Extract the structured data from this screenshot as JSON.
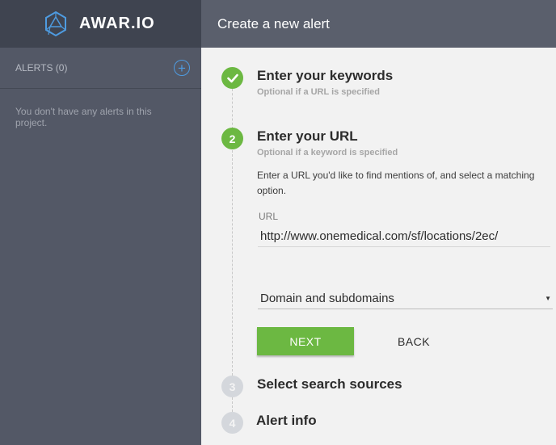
{
  "brand": {
    "name": "AWAR.IO",
    "logo_icon": "hexagon-logo-icon",
    "logo_color": "#4e9be0"
  },
  "header": {
    "title": "Create a new alert"
  },
  "sidebar": {
    "alerts_title": "ALERTS (0)",
    "add_icon": "plus-circle-icon",
    "empty_message": "You don't have any alerts in this project."
  },
  "steps": [
    {
      "number": "",
      "icon": "checkmark-icon",
      "status": "done",
      "title": "Enter your keywords",
      "subtitle": "Optional if a URL is specified"
    },
    {
      "number": "2",
      "status": "active",
      "title": "Enter your URL",
      "subtitle": "Optional if a keyword is specified",
      "description": "Enter a URL you'd like to find mentions of, and select a matching option.",
      "url_label": "URL",
      "url_value": "http://www.onemedical.com/sf/locations/2ec/",
      "match_option": "Domain and subdomains",
      "next_label": "NEXT",
      "back_label": "BACK"
    },
    {
      "number": "3",
      "status": "inactive",
      "title": "Select search sources"
    },
    {
      "number": "4",
      "status": "inactive",
      "title": "Alert info"
    }
  ],
  "colors": {
    "accent_green": "#6cb842",
    "accent_blue": "#4e9be0",
    "sidebar_bg": "#535866"
  }
}
